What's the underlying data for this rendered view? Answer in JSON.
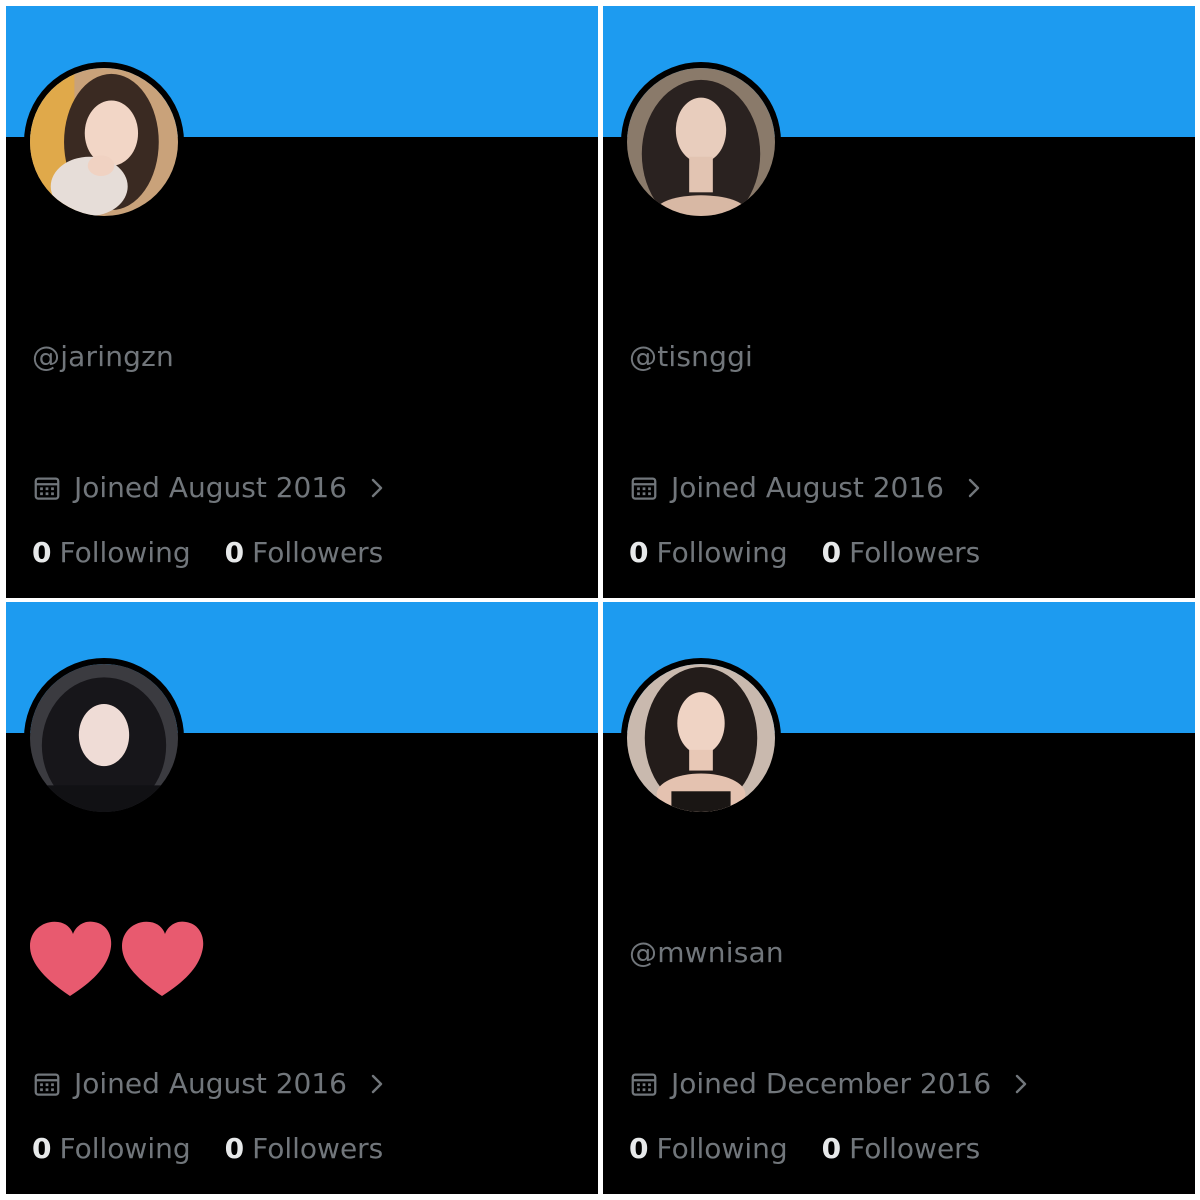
{
  "colors": {
    "banner": "#1d9bf0",
    "background": "#000000",
    "muted_text": "#71767b",
    "primary_text": "#e7e9ea",
    "heart_sticker": "#e85a6f"
  },
  "icons": {
    "joined": "calendar-icon",
    "expand": "chevron-right-icon",
    "censor": "heart-icon"
  },
  "profiles": [
    {
      "handle": "@jaringzn",
      "joined": "Joined August 2016",
      "following_count": "0",
      "following_label": "Following",
      "followers_count": "0",
      "followers_label": "Followers"
    },
    {
      "handle": "@tisnggi",
      "joined": "Joined August 2016",
      "following_count": "0",
      "following_label": "Following",
      "followers_count": "0",
      "followers_label": "Followers"
    },
    {
      "handle": "",
      "joined": "Joined August 2016",
      "following_count": "0",
      "following_label": "Following",
      "followers_count": "0",
      "followers_label": "Followers"
    },
    {
      "handle": "@mwnisan",
      "joined": "Joined December 2016",
      "following_count": "0",
      "following_label": "Following",
      "followers_count": "0",
      "followers_label": "Followers"
    }
  ]
}
